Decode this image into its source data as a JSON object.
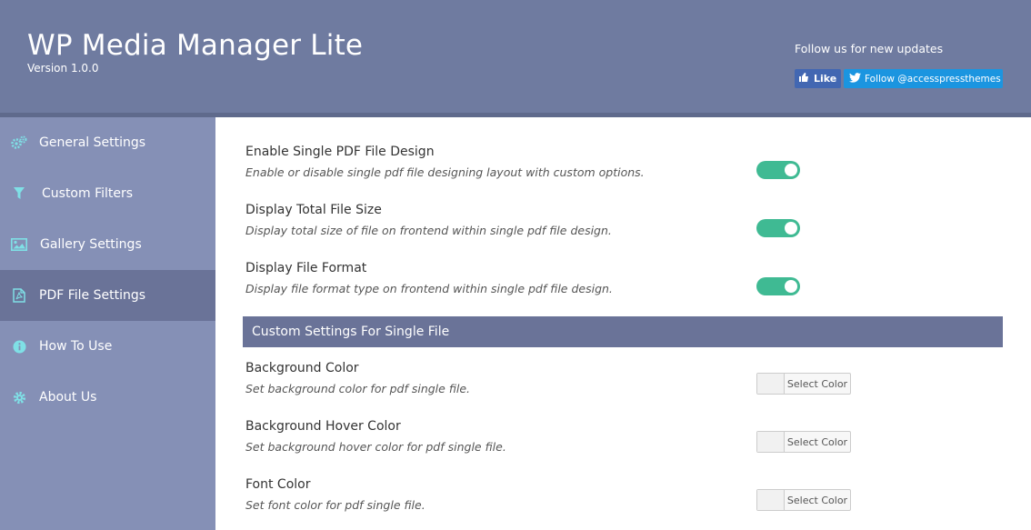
{
  "header": {
    "title": "WP Media Manager Lite",
    "version": "Version 1.0.0",
    "follow_text": "Follow us for new updates",
    "like_label": "Like",
    "twitter_label": "Follow @accesspressthemes"
  },
  "sidebar": {
    "items": [
      {
        "label": "General Settings",
        "icon": "gears-icon"
      },
      {
        "label": "Custom Filters",
        "icon": "filter-icon"
      },
      {
        "label": "Gallery Settings",
        "icon": "image-icon"
      },
      {
        "label": "PDF File Settings",
        "icon": "pdf-file-icon",
        "active": true
      },
      {
        "label": "How To Use",
        "icon": "info-icon"
      },
      {
        "label": "About Us",
        "icon": "gear-icon"
      }
    ]
  },
  "settings": [
    {
      "label": "Enable Single PDF File Design",
      "desc": "Enable or disable single pdf file designing layout with custom options.",
      "enabled": true
    },
    {
      "label": "Display Total File Size",
      "desc": "Display total size of file on frontend within single pdf file design.",
      "enabled": true
    },
    {
      "label": "Display File Format",
      "desc": "Display file format type on frontend within single pdf file design.",
      "enabled": true
    }
  ],
  "section_title": "Custom Settings For Single File",
  "color_settings": [
    {
      "label": "Background Color",
      "desc": "Set background color for pdf single file.",
      "button": "Select Color"
    },
    {
      "label": "Background Hover Color",
      "desc": "Set background hover color for pdf single file.",
      "button": "Select Color"
    },
    {
      "label": "Font Color",
      "desc": "Set font color for pdf single file.",
      "button": "Select Color"
    }
  ],
  "colors": {
    "header": "#6f7ba0",
    "sidebar": "#8590b6",
    "active": "#6a7398",
    "toggle_on": "#3fba93",
    "icon_accent": "#7fe0e6"
  }
}
